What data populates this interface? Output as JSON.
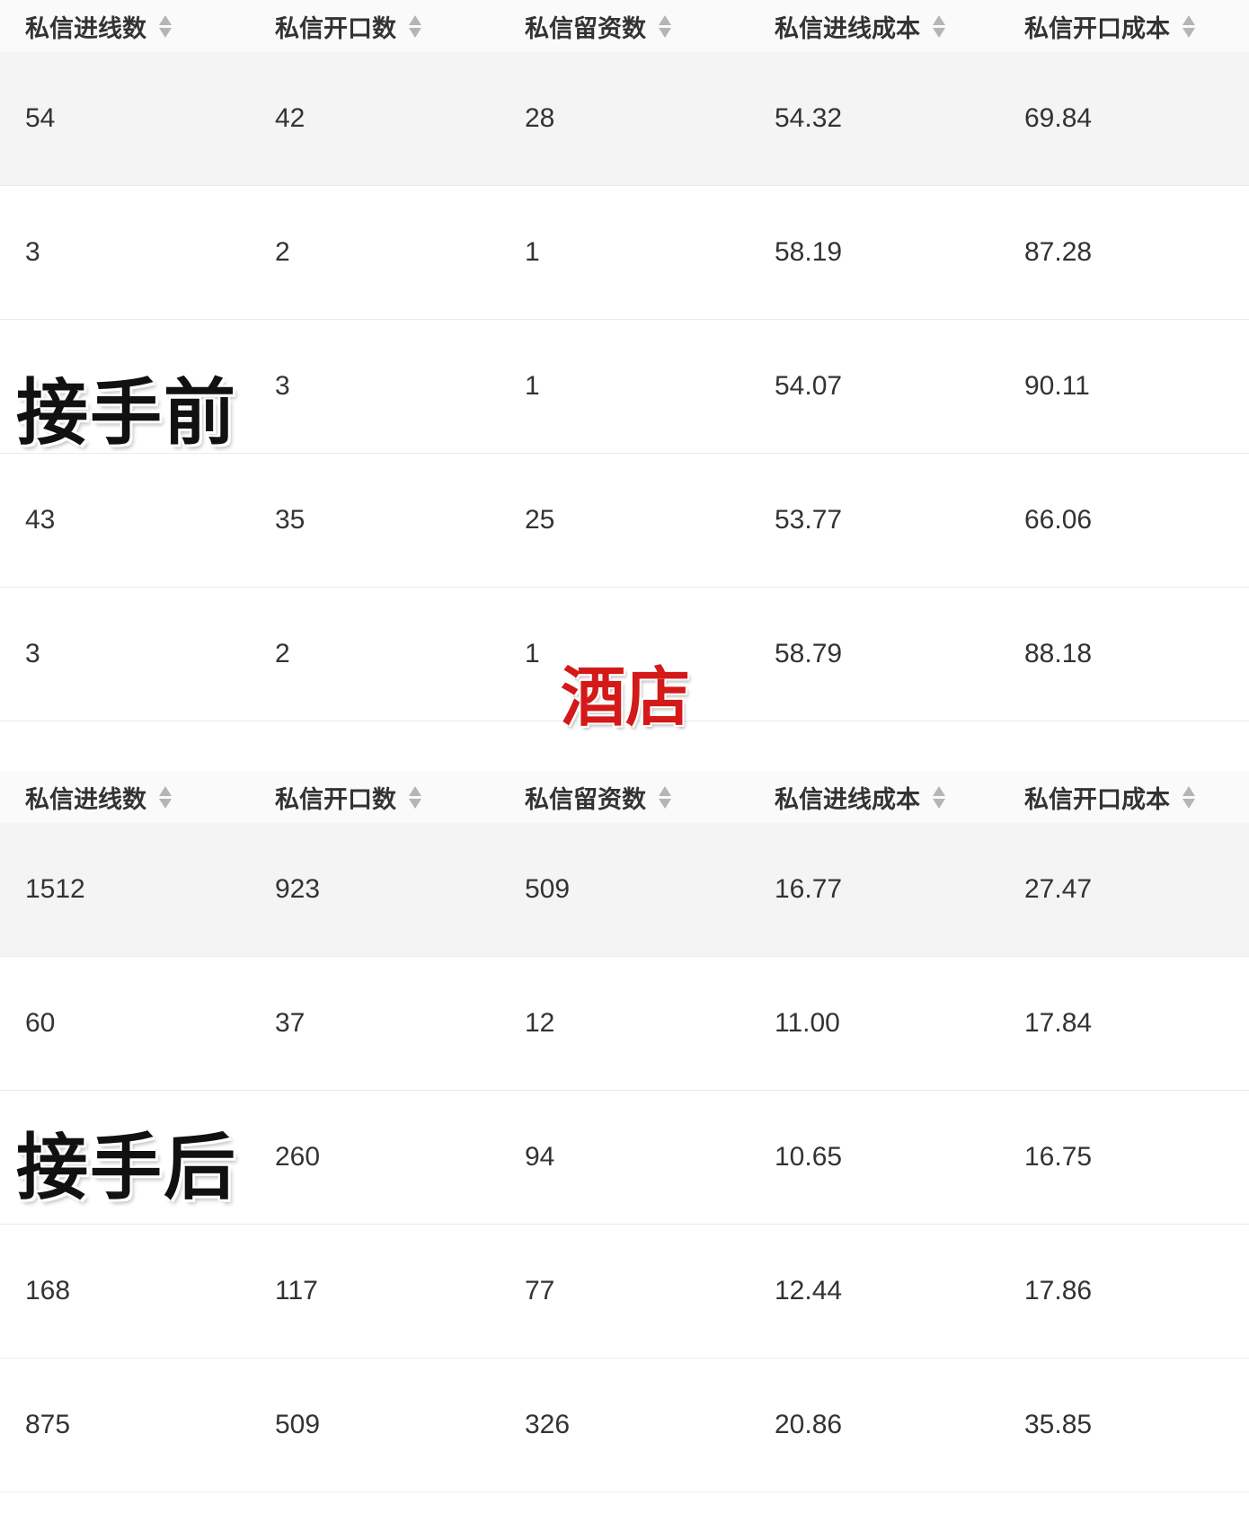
{
  "columns": [
    "私信进线数",
    "私信开口数",
    "私信留资数",
    "私信进线成本",
    "私信开口成本"
  ],
  "overlays": {
    "before": "接手前",
    "after": "接手后",
    "hotel": "酒店"
  },
  "table_before": {
    "rows": [
      [
        "54",
        "42",
        "28",
        "54.32",
        "69.84"
      ],
      [
        "3",
        "2",
        "1",
        "58.19",
        "87.28"
      ],
      [
        "",
        "3",
        "1",
        "54.07",
        "90.11"
      ],
      [
        "43",
        "35",
        "25",
        "53.77",
        "66.06"
      ],
      [
        "3",
        "2",
        "1",
        "58.79",
        "88.18"
      ]
    ]
  },
  "table_after": {
    "rows": [
      [
        "1512",
        "923",
        "509",
        "16.77",
        "27.47"
      ],
      [
        "60",
        "37",
        "12",
        "11.00",
        "17.84"
      ],
      [
        "",
        "260",
        "94",
        "10.65",
        "16.75"
      ],
      [
        "168",
        "117",
        "77",
        "12.44",
        "17.86"
      ],
      [
        "875",
        "509",
        "326",
        "20.86",
        "35.85"
      ]
    ]
  },
  "colors": {
    "header_bg": "#fafafa",
    "highlight_row_bg": "#f4f4f4",
    "hotel_label": "#d41919",
    "sort_icon": "#b5b5b5"
  }
}
